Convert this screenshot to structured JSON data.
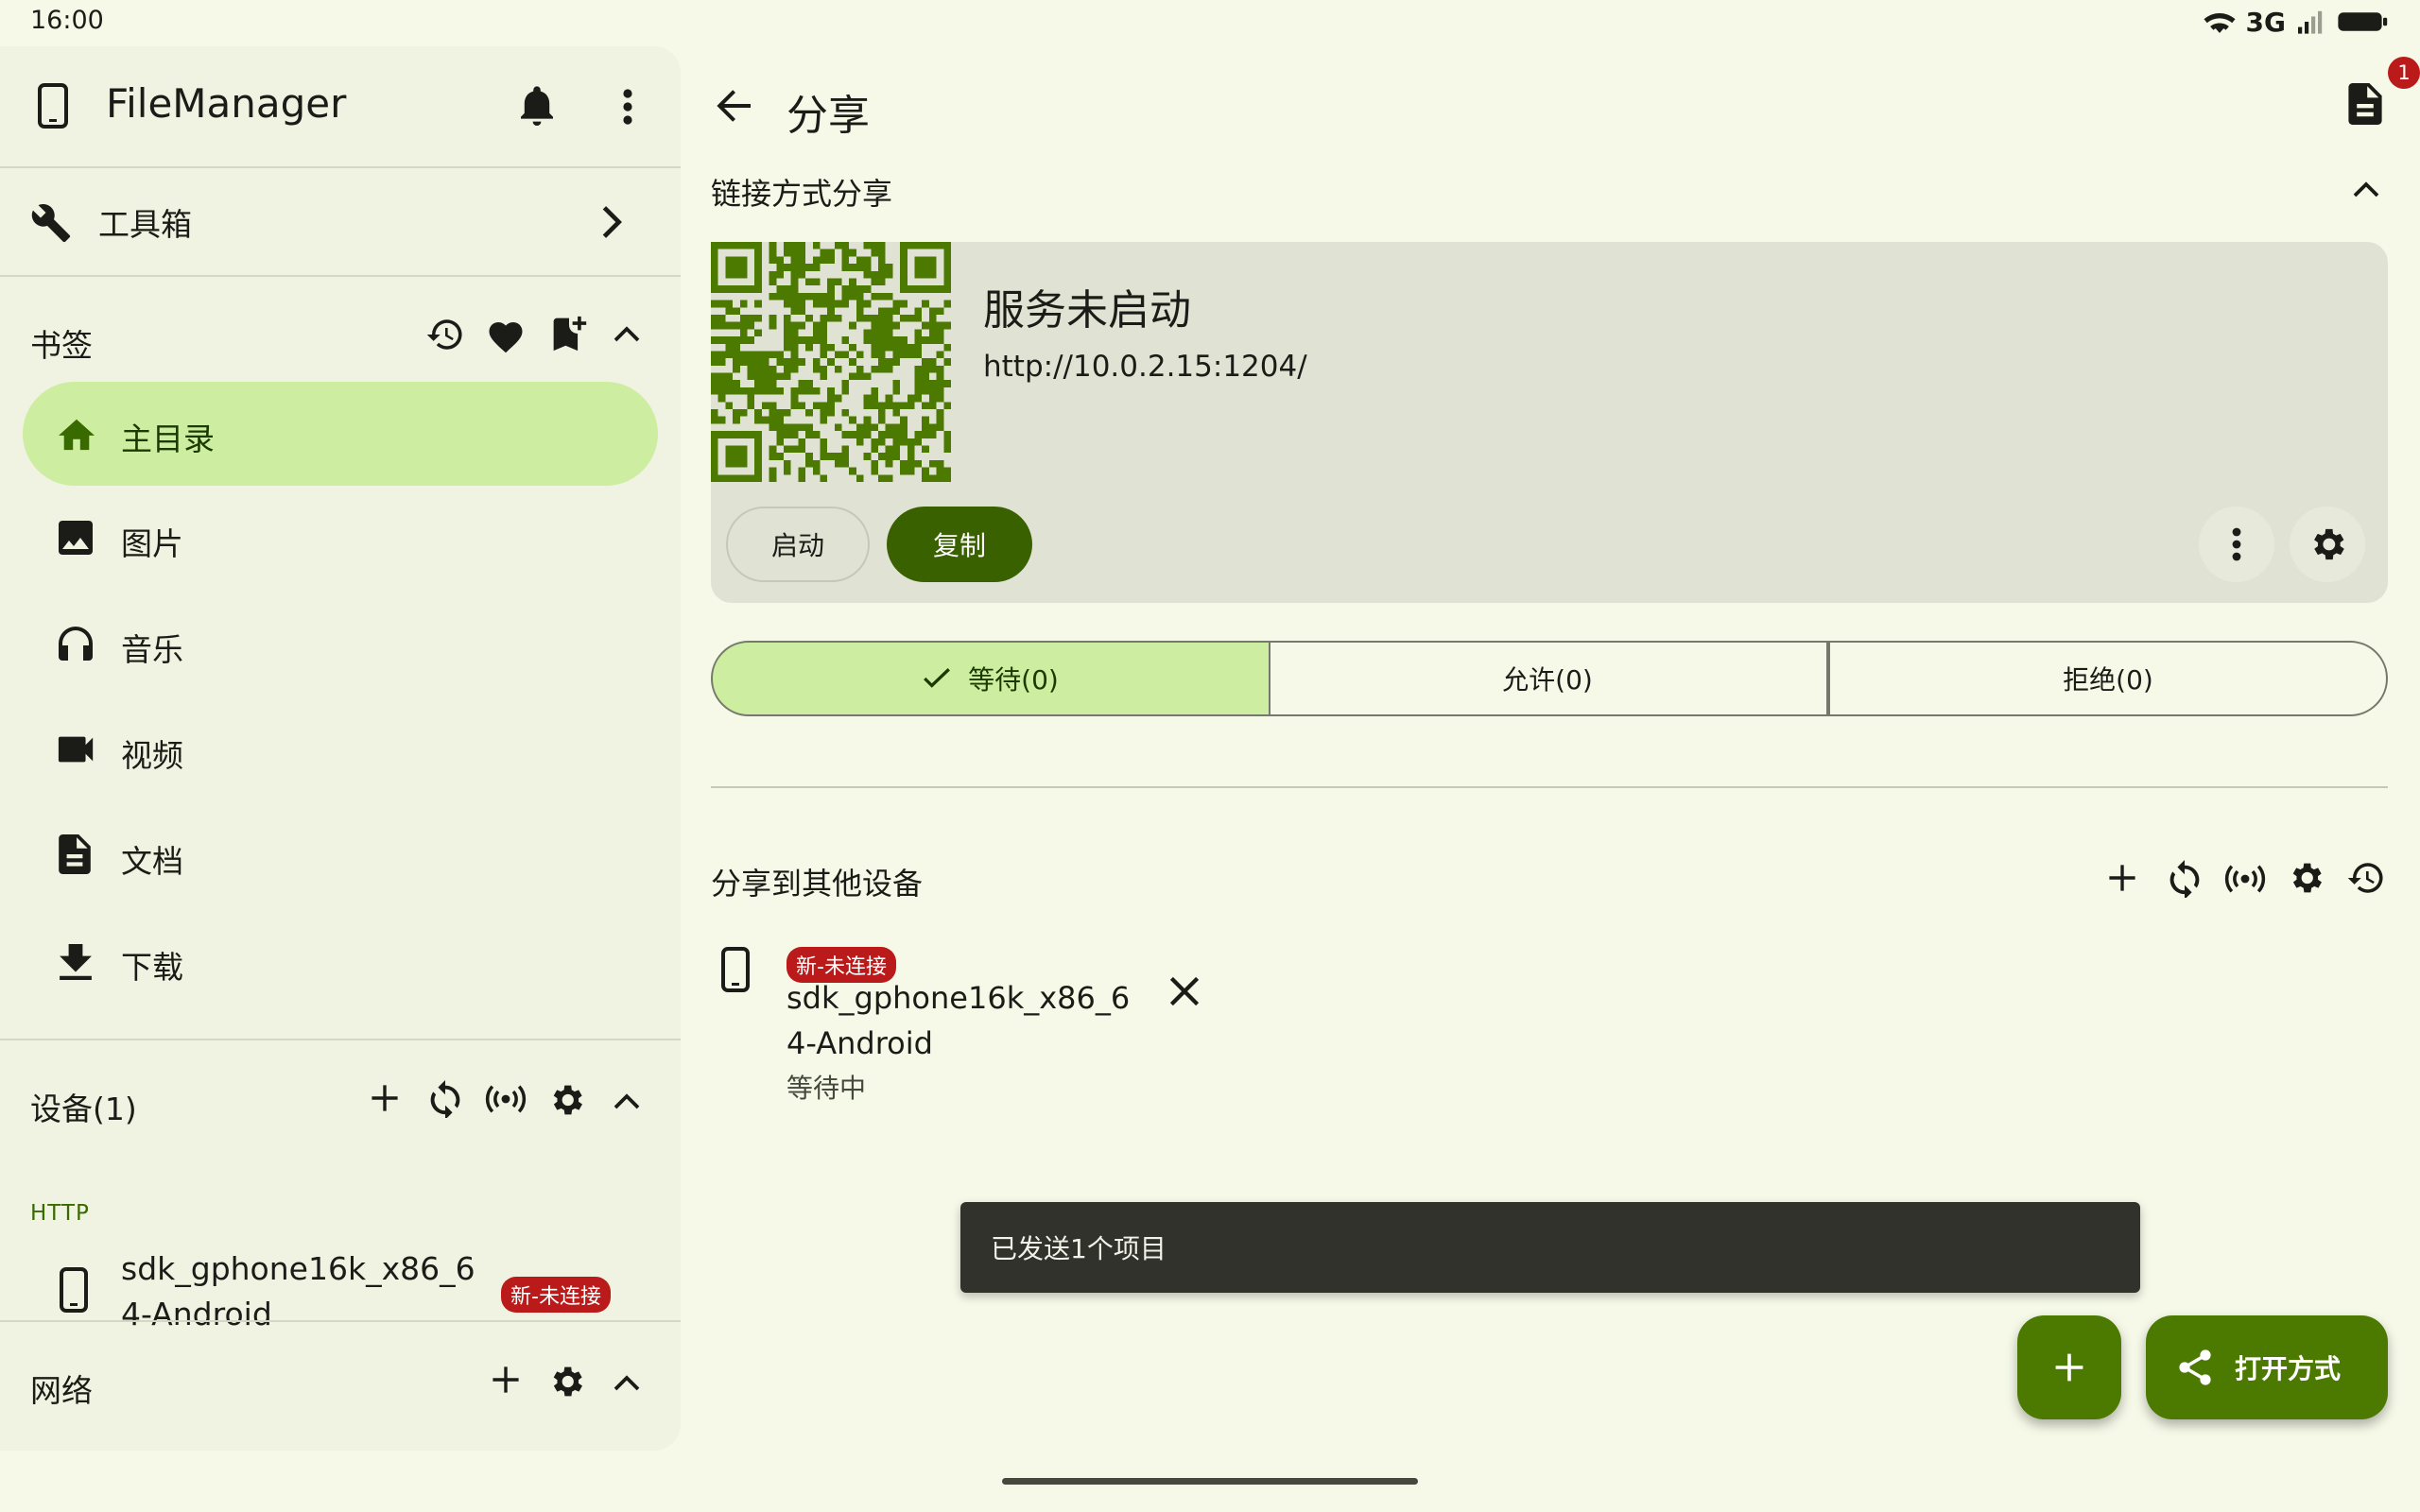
{
  "status": {
    "time": "16:00",
    "network": "3G"
  },
  "drawer": {
    "app_title": "FileManager",
    "toolbox_label": "工具箱",
    "bookmarks": {
      "header": "书签",
      "items": [
        {
          "label": "主目录",
          "icon": "home-icon",
          "active": true
        },
        {
          "label": "图片",
          "icon": "image-icon"
        },
        {
          "label": "音乐",
          "icon": "headphones-icon"
        },
        {
          "label": "视频",
          "icon": "video-icon"
        },
        {
          "label": "文档",
          "icon": "document-icon"
        },
        {
          "label": "下载",
          "icon": "download-icon"
        }
      ]
    },
    "devices": {
      "header": "设备(1)",
      "section_label": "HTTP",
      "device_name": "sdk_gphone16k_x86_64-Android",
      "device_badge": "新-未连接"
    },
    "network_header": "网络"
  },
  "main": {
    "title": "分享",
    "notification_count": "1",
    "link_share": {
      "header": "链接方式分享",
      "service_status": "服务未启动",
      "url": "http://10.0.2.15:1204/",
      "start_label": "启动",
      "copy_label": "复制"
    },
    "segments": {
      "waiting": "等待(0)",
      "allowed": "允许(0)",
      "rejected": "拒绝(0)"
    },
    "other_devices": {
      "header": "分享到其他设备",
      "badge": "新-未连接",
      "device_name_line1": "sdk_gphone16k_x86_6",
      "device_name_line2": "4-Android",
      "status": "等待中"
    },
    "snackbar": "已发送1个项目",
    "open_with_label": "打开方式"
  },
  "colors": {
    "background": "#f6f9e8",
    "primary": "#4c7a00",
    "primary_dark": "#3a6100",
    "selected_container": "#cdeda0",
    "error": "#ba1a1a"
  }
}
